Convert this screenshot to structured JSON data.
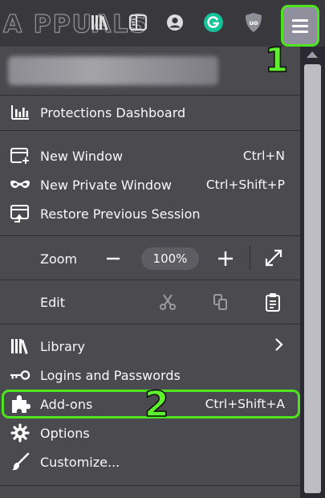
{
  "watermark": {
    "text": "A PPUALS"
  },
  "menu": {
    "protections": "Protections Dashboard",
    "new_window": {
      "label": "New Window",
      "shortcut": "Ctrl+N"
    },
    "new_private": {
      "label": "New Private Window",
      "shortcut": "Ctrl+Shift+P"
    },
    "restore": "Restore Previous Session",
    "zoom": {
      "label": "Zoom",
      "value": "100%"
    },
    "edit": "Edit",
    "library": "Library",
    "logins": "Logins and Passwords",
    "addons": {
      "label": "Add-ons",
      "shortcut": "Ctrl+Shift+A"
    },
    "options": "Options",
    "customize": "Customize..."
  },
  "annotations": {
    "step1": "1",
    "step2": "2"
  },
  "colors": {
    "highlight": "#4ce51f",
    "panel": "#4a4a4f",
    "toolbar": "#38383d"
  }
}
